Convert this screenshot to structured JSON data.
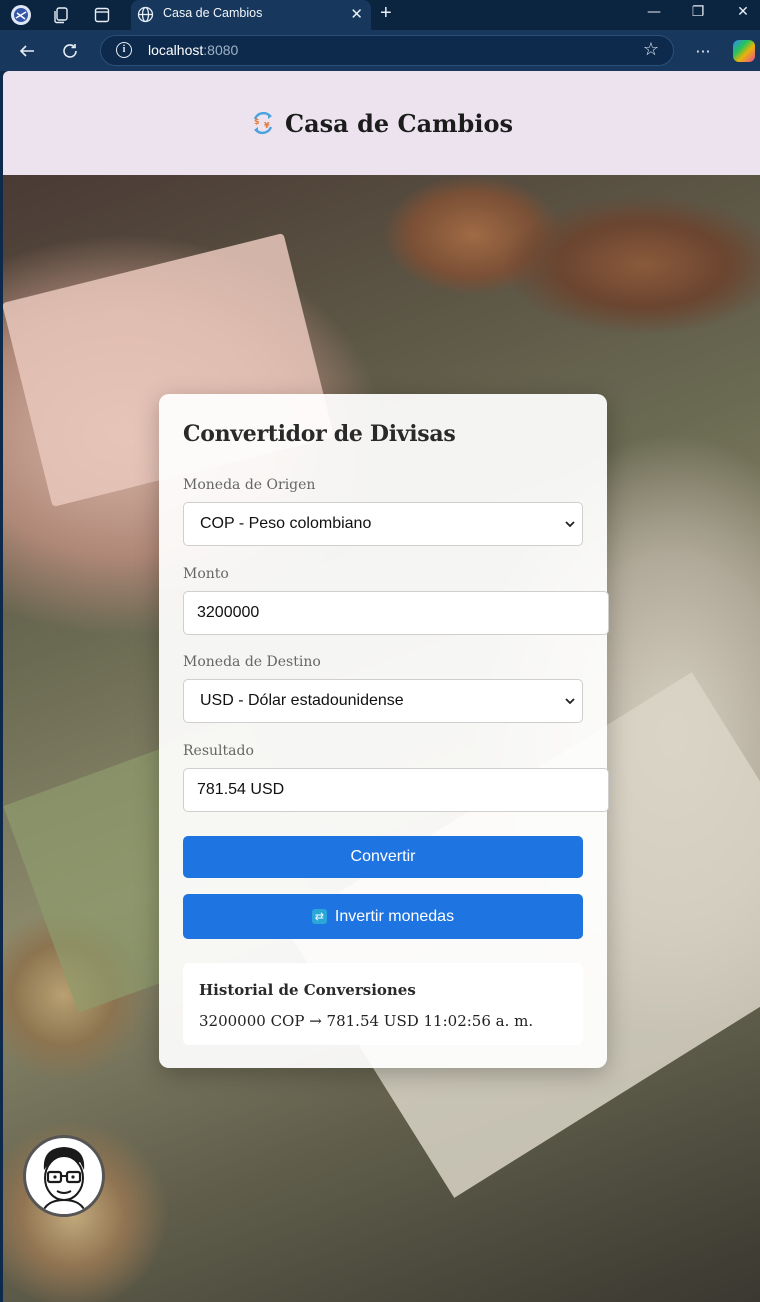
{
  "browser": {
    "tab_title": "Casa de Cambios",
    "address_host": "localhost",
    "address_port": ":8080",
    "icons": [
      "profile-icon",
      "workspaces-icon",
      "tab-actions-icon",
      "globe-icon",
      "close-icon",
      "new-tab-icon",
      "minimize-icon",
      "restore-icon",
      "close-window-icon",
      "back-icon",
      "refresh-icon",
      "info-icon",
      "favorite-star-icon",
      "more-icon",
      "copilot-icon"
    ]
  },
  "header": {
    "title": "Casa de Cambios",
    "logo_icon": "currency-exchange-icon"
  },
  "converter": {
    "title": "Convertidor de Divisas",
    "origin_label": "Moneda de Origen",
    "origin_value": "COP - Peso colombiano",
    "amount_label": "Monto",
    "amount_value": "3200000",
    "target_label": "Moneda de Destino",
    "target_value": "USD - Dólar estadounidense",
    "result_label": "Resultado",
    "result_value": "781.54 USD",
    "convert_button": "Convertir",
    "swap_button": "Invertir monedas",
    "swap_icon": "swap-icon"
  },
  "history": {
    "title": "Historial de Conversiones",
    "items": [
      "3200000 COP → 781.54 USD 11:02:56 a. m."
    ]
  },
  "colors": {
    "header_bg": "#ece3ef",
    "primary_button": "#1e74e0",
    "browser_chrome": "#17385c"
  }
}
